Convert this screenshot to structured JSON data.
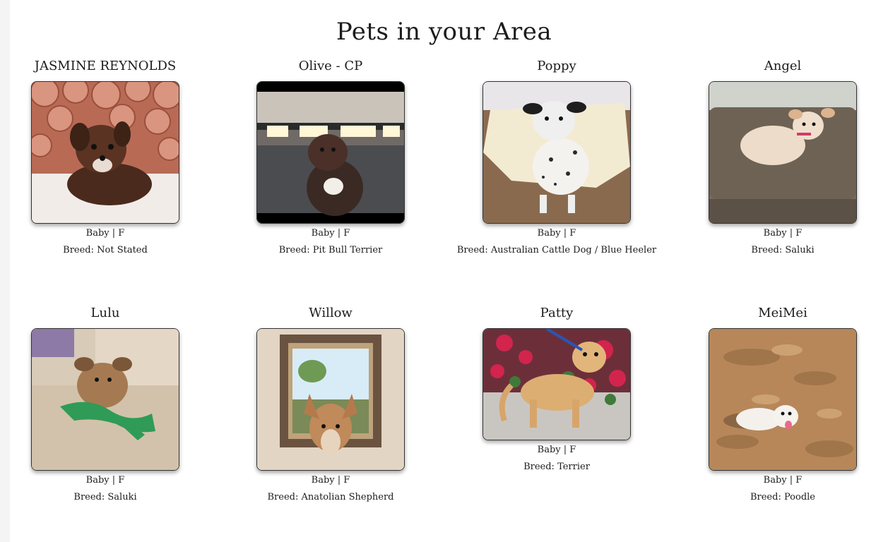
{
  "page": {
    "title": "Pets in your Area"
  },
  "pets": [
    {
      "name": "JASMINE REYNOLDS",
      "age_sex": "Baby | F",
      "breed": "Breed: Not Stated",
      "photo": "brown-chihuahua-mix-photo"
    },
    {
      "name": "Olive - CP",
      "age_sex": "Baby | F",
      "breed": "Breed: Pit Bull Terrier",
      "photo": "pit-bull-puppy-in-car-photo"
    },
    {
      "name": "Poppy",
      "age_sex": "Baby | F",
      "breed": "Breed: Australian Cattle Dog / Blue Heeler",
      "photo": "heeler-on-mat-photo"
    },
    {
      "name": "Angel",
      "age_sex": "Baby | F",
      "breed": "Breed: Saluki",
      "photo": "cream-puppy-on-couch-photo"
    },
    {
      "name": "Lulu",
      "age_sex": "Baby | F",
      "breed": "Breed: Saluki",
      "photo": "puppy-with-green-toy-photo"
    },
    {
      "name": "Willow",
      "age_sex": "Baby | F",
      "breed": "Breed: Anatolian Shepherd",
      "photo": "puppy-through-doggy-door-photo"
    },
    {
      "name": "Patty",
      "age_sex": "Baby | F",
      "breed": "Breed: Terrier",
      "photo": "tan-terrier-by-flowers-photo"
    },
    {
      "name": "MeiMei",
      "age_sex": "Baby | F",
      "breed": "Breed: Poodle",
      "photo": "white-poodle-on-dirt-photo"
    }
  ],
  "colors": {
    "text": "#1c1c1c",
    "card_border": "#333333",
    "background": "#ffffff"
  }
}
